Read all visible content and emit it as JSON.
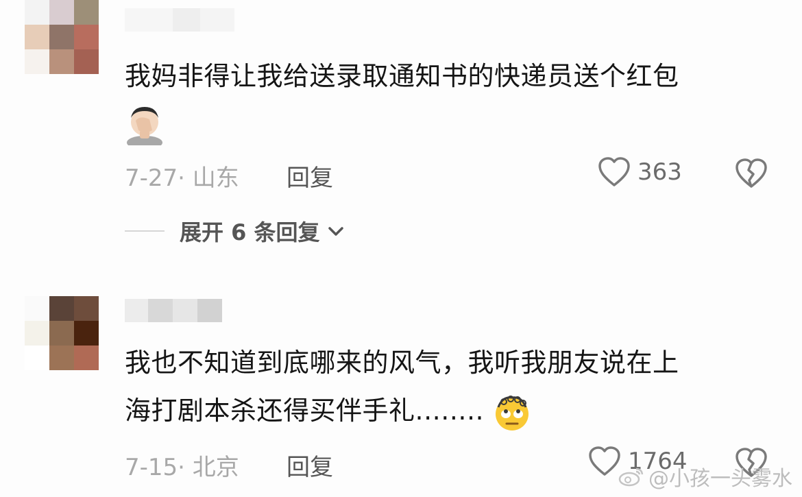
{
  "comments": [
    {
      "text_lines": [
        "我妈非得让我给送录取通知书的快递员送个红包"
      ],
      "emoji": "facepalm-emoji",
      "date": "7-27",
      "location": "山东",
      "reply_label": "回复",
      "likes": "363",
      "expand_label": "展开 6 条回复"
    },
    {
      "text_lines": [
        "我也不知道到底哪来的风气，我听我朋友说在上",
        "海打剧本杀还得买伴手礼........"
      ],
      "emoji": "eye-roll-emoji",
      "date": "7-15",
      "location": "北京",
      "reply_label": "回复",
      "likes": "1764"
    }
  ],
  "meta_separator": "·",
  "watermark": "@小孩一头雾水",
  "colors": {
    "text": "#151515",
    "meta": "#a8a8a8",
    "icon": "#7a7a7a",
    "background": "#fdfdfd"
  }
}
